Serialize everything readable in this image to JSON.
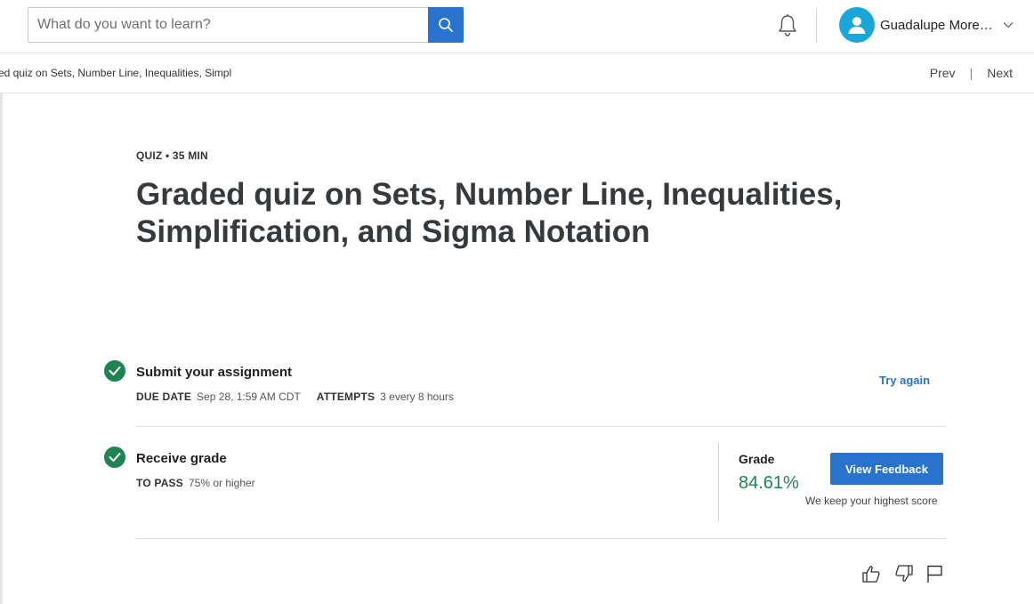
{
  "header": {
    "search_placeholder": "What do you want to learn?",
    "user_name": "Guadalupe Moreno..."
  },
  "breadcrumb": {
    "text": "ed quiz on Sets, Number Line, Inequalities, Simpl",
    "prev_label": "Prev",
    "separator": "|",
    "next_label": "Next"
  },
  "main": {
    "meta": "QUIZ • 35 MIN",
    "title": "Graded quiz on Sets, Number Line, Inequalities, Simplification, and Sigma Notation",
    "submit": {
      "title": "Submit your assignment",
      "due_label": "DUE DATE",
      "due_value": "Sep 28, 1:59 AM CDT",
      "attempts_label": "ATTEMPTS",
      "attempts_value": "3 every 8 hours",
      "try_again_label": "Try again"
    },
    "receive": {
      "title": "Receive grade",
      "pass_label": "TO PASS",
      "pass_value": "75% or higher",
      "grade_label": "Grade",
      "grade_value": "84.61%",
      "view_feedback_label": "View Feedback",
      "keep_note": "We keep your highest score"
    }
  },
  "icons": {
    "search": "search-icon",
    "bell": "bell-icon",
    "avatar": "user-avatar-icon",
    "chevron": "chevron-down-icon",
    "check": "check-circle-icon",
    "like": "thumbs-up-icon",
    "dislike": "thumbs-down-icon",
    "flag": "flag-icon"
  },
  "colors": {
    "accent": "#2a73cc",
    "success": "#1f8354",
    "avatar": "#1aa6d9"
  }
}
